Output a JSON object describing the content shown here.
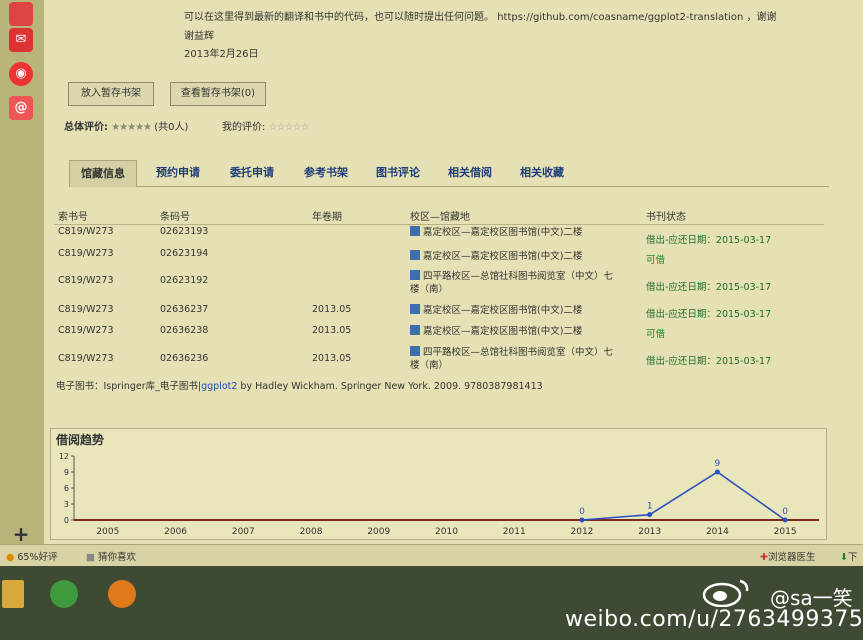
{
  "intro": {
    "line1": "可以在这里得到最新的翻译和书中的代码，也可以随时提出任何问题。",
    "github": "https://github.com/coasname/ggplot2-translation ，谢谢",
    "author": "谢益辉",
    "date": "2013年2月26日"
  },
  "actions": {
    "add_shelf": "放入暂存书架",
    "view_shelf": "查看暂存书架(0)"
  },
  "rating": {
    "overall_label": "总体评价:",
    "overall_count": "(共0人)",
    "my_label": "我的评价:"
  },
  "tabs": [
    "馆藏信息",
    "预约申请",
    "委托申请",
    "参考书架",
    "图书评论",
    "相关借阅",
    "相关收藏"
  ],
  "holdings": {
    "headers": [
      "索书号",
      "条码号",
      "年卷期",
      "校区—馆藏地",
      "书刊状态"
    ],
    "rows": [
      {
        "call": "C819/W273",
        "barcode": "02623193",
        "year": "",
        "loc": "嘉定校区—嘉定校区图书馆(中文)二楼",
        "status": "借出-应还日期：2015-03-17"
      },
      {
        "call": "C819/W273",
        "barcode": "02623194",
        "year": "",
        "loc": "嘉定校区—嘉定校区图书馆(中文)二楼",
        "status": "可借"
      },
      {
        "call": "C819/W273",
        "barcode": "02623192",
        "year": "",
        "loc": "四平路校区—总馆社科图书阅览室（中文）七楼（南）",
        "status": "借出-应还日期：2015-03-17"
      },
      {
        "call": "C819/W273",
        "barcode": "02636237",
        "year": "2013.05",
        "loc": "嘉定校区—嘉定校区图书馆(中文)二楼",
        "status": "借出-应还日期：2015-03-17"
      },
      {
        "call": "C819/W273",
        "barcode": "02636238",
        "year": "2013.05",
        "loc": "嘉定校区—嘉定校区图书馆(中文)二楼",
        "status": "可借"
      },
      {
        "call": "C819/W273",
        "barcode": "02636236",
        "year": "2013.05",
        "loc": "四平路校区—总馆社科图书阅览室（中文）七楼（南）",
        "status": "借出-应还日期：2015-03-17"
      }
    ]
  },
  "ebook": {
    "prefix": "电子图书：Ispringer库_电子图书|",
    "link": "ggplot2",
    "suffix": " by Hadley Wickham. Springer New York. 2009. 9780387981413"
  },
  "trend_title": "借阅趋势",
  "chart_data": {
    "type": "line",
    "categories": [
      "2005",
      "2006",
      "2007",
      "2008",
      "2009",
      "2010",
      "2011",
      "2012",
      "2013",
      "2014",
      "2015"
    ],
    "values": [
      null,
      null,
      null,
      null,
      null,
      null,
      null,
      0,
      1,
      9,
      0
    ],
    "data_labels": [
      "",
      "",
      "",
      "",
      "",
      "",
      "",
      "0",
      "1",
      "9",
      "0"
    ],
    "y_ticks": [
      "0",
      "3",
      "6",
      "9",
      "12"
    ],
    "ylim": [
      0,
      12
    ],
    "line_color": "#2b4fbf"
  },
  "statusbar": {
    "rating": "65%好评",
    "guess": "猜你喜欢",
    "doctor": "浏览器医生",
    "download": "下"
  },
  "watermark": {
    "user": "@sa一笑",
    "url": "weibo.com/u/2763499375"
  }
}
